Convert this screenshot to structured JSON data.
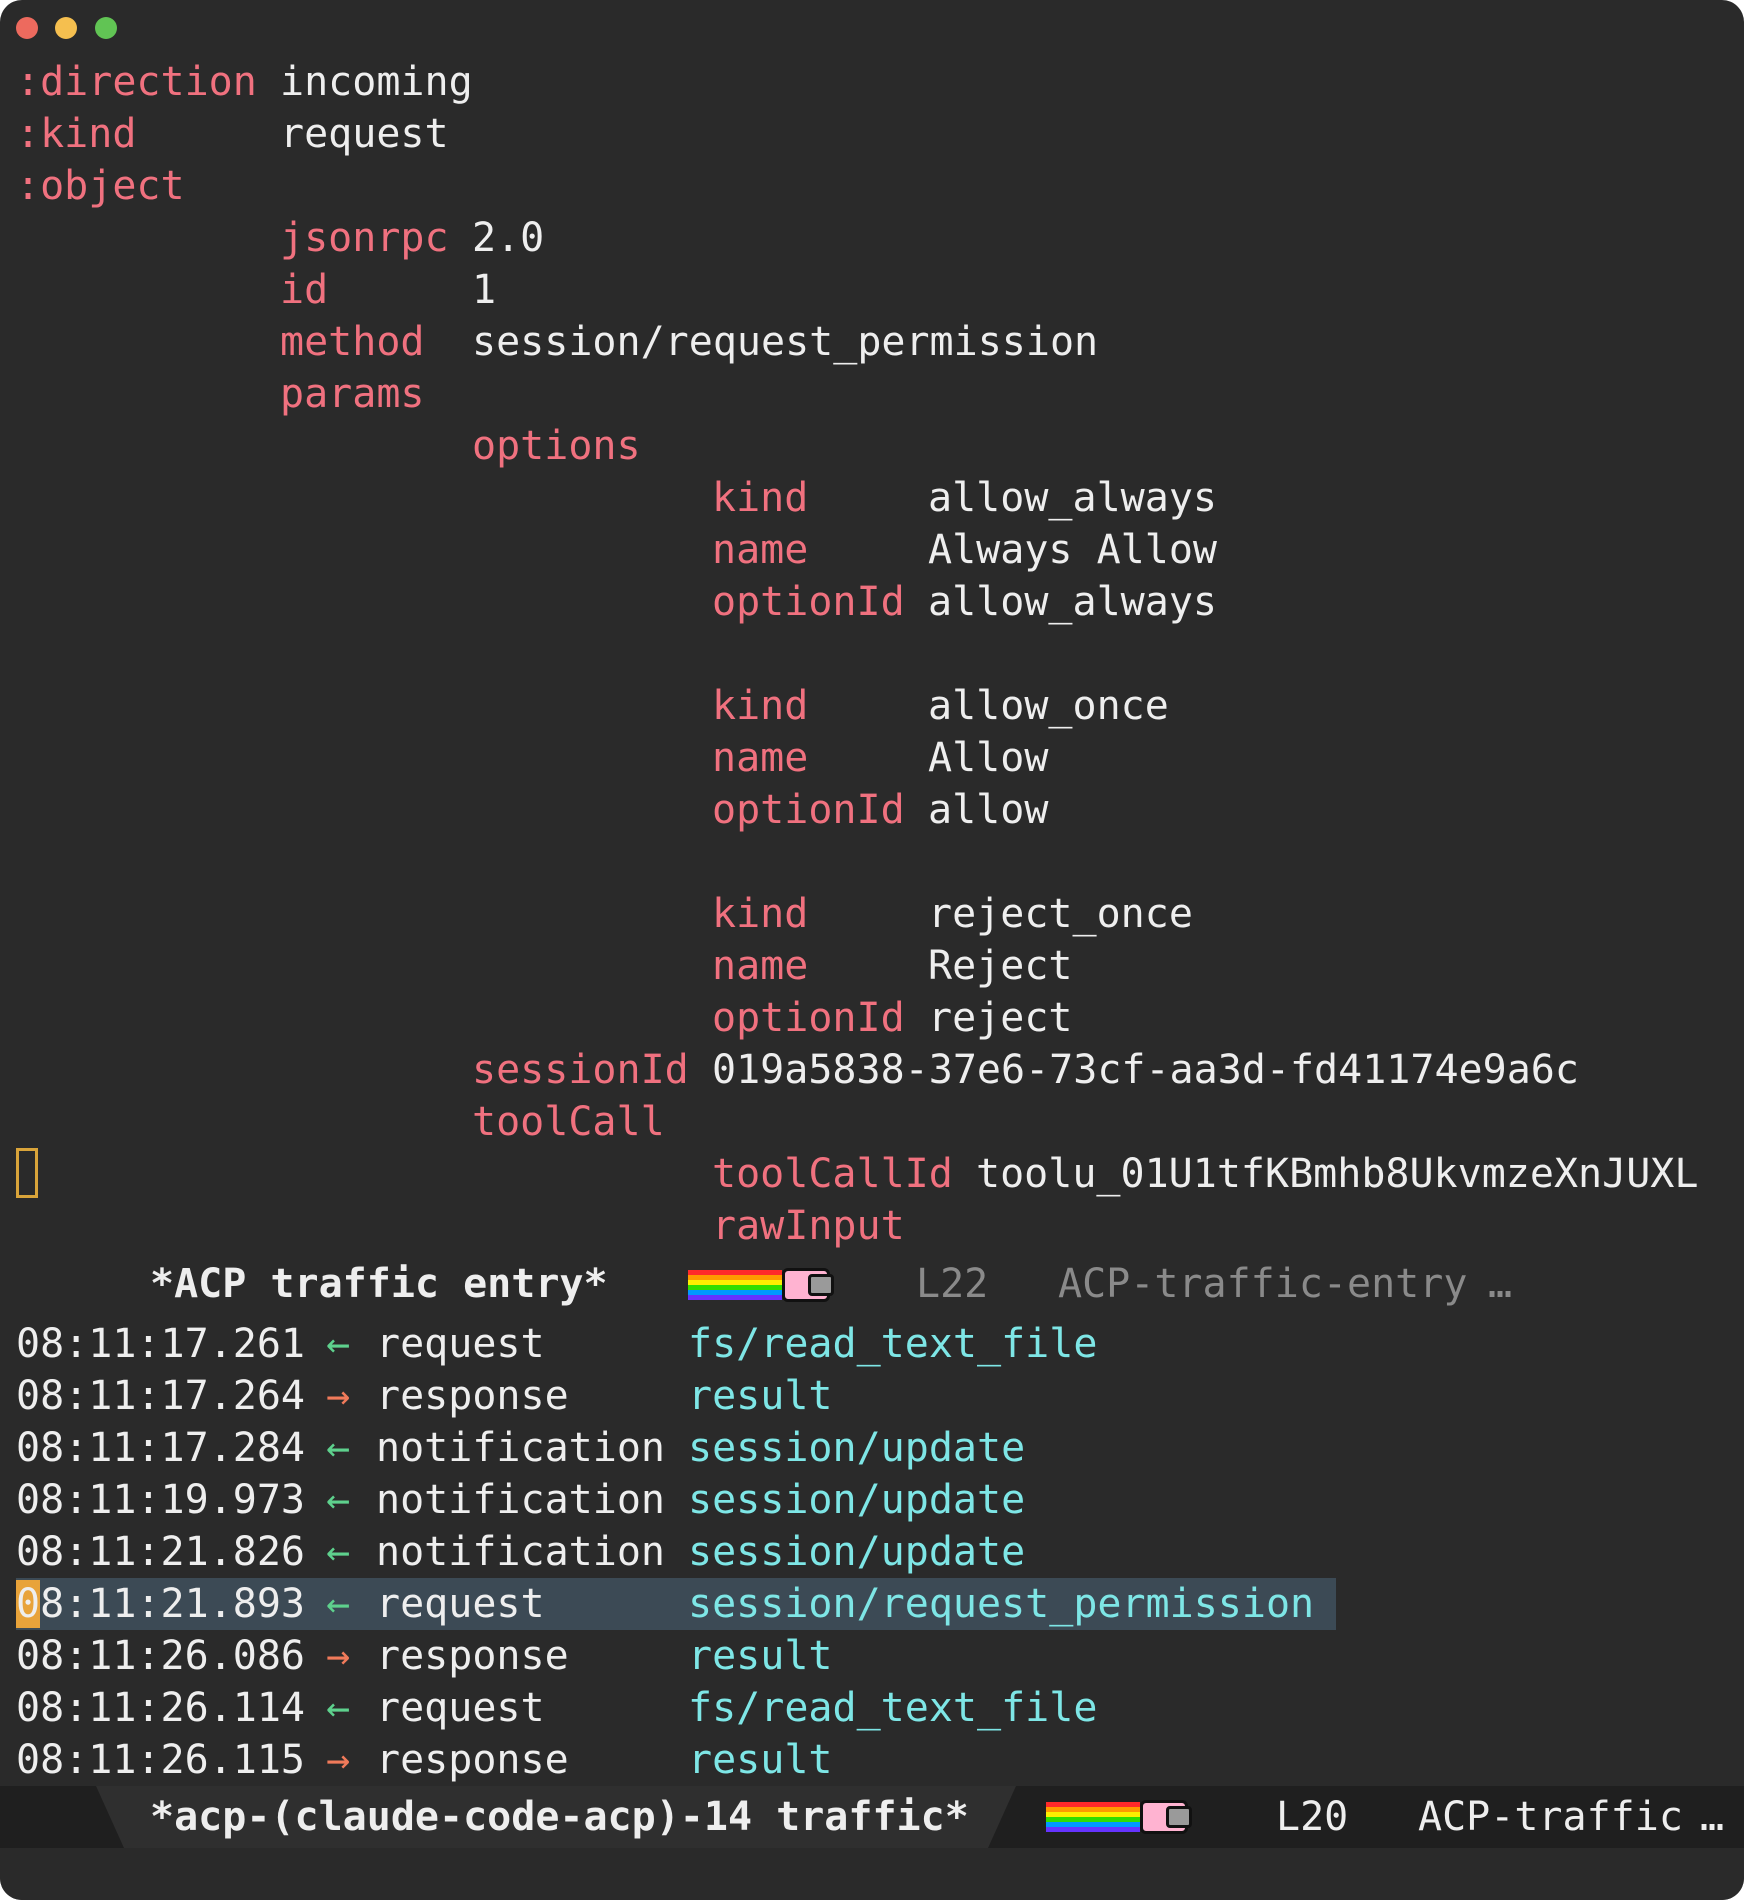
{
  "entry": {
    "direction_key": ":direction",
    "direction_val": "incoming",
    "kind_key": ":kind",
    "kind_val": "request",
    "object_key": ":object",
    "jsonrpc_key": "jsonrpc",
    "jsonrpc_val": "2.0",
    "id_key": "id",
    "id_val": "1",
    "method_key": "method",
    "method_val": "session/request_permission",
    "params_key": "params",
    "options_key": "options",
    "options": [
      {
        "kind_key": "kind",
        "kind": "allow_always",
        "name_key": "name",
        "name": "Always Allow",
        "optionId_key": "optionId",
        "optionId": "allow_always"
      },
      {
        "kind_key": "kind",
        "kind": "allow_once",
        "name_key": "name",
        "name": "Allow",
        "optionId_key": "optionId",
        "optionId": "allow"
      },
      {
        "kind_key": "kind",
        "kind": "reject_once",
        "name_key": "name",
        "name": "Reject",
        "optionId_key": "optionId",
        "optionId": "reject"
      }
    ],
    "sessionId_key": "sessionId",
    "sessionId_val": "019a5838-37e6-73cf-aa3d-fd41174e9a6c",
    "toolCall_key": "toolCall",
    "toolCallId_key": "toolCallId",
    "toolCallId_val": "toolu_01U1tfKBmhb8UkvmzeXnJUXL",
    "rawInput_key": "rawInput"
  },
  "modeline_top": {
    "buffer_name": "*ACP traffic entry*",
    "line": "L22",
    "mode": "ACP-traffic-entry",
    "ellipsis": "…"
  },
  "traffic": {
    "rows": [
      {
        "time": "08:11:17.261",
        "arrow": "←",
        "dir": "in",
        "kind": "request",
        "method": "fs/read_text_file"
      },
      {
        "time": "08:11:17.264",
        "arrow": "→",
        "dir": "out",
        "kind": "response",
        "method": "result"
      },
      {
        "time": "08:11:17.284",
        "arrow": "←",
        "dir": "in",
        "kind": "notification",
        "method": "session/update"
      },
      {
        "time": "08:11:19.973",
        "arrow": "←",
        "dir": "in",
        "kind": "notification",
        "method": "session/update"
      },
      {
        "time": "08:11:21.826",
        "arrow": "←",
        "dir": "in",
        "kind": "notification",
        "method": "session/update"
      },
      {
        "time": "08:11:21.893",
        "arrow": "←",
        "dir": "in",
        "kind": "request",
        "method": "session/request_permission"
      },
      {
        "time": "08:11:26.086",
        "arrow": "→",
        "dir": "out",
        "kind": "response",
        "method": "result"
      },
      {
        "time": "08:11:26.114",
        "arrow": "←",
        "dir": "in",
        "kind": "request",
        "method": "fs/read_text_file"
      },
      {
        "time": "08:11:26.115",
        "arrow": "→",
        "dir": "out",
        "kind": "response",
        "method": "result"
      }
    ],
    "selected_index": 5
  },
  "modeline_bottom": {
    "buffer_name": "*acp-(claude-code-acp)-14 traffic*",
    "line": "L20",
    "mode": "ACP-traffic",
    "ellipsis": "…"
  },
  "colors": {
    "background": "#2a2a2a",
    "key": "#f0717f",
    "value": "#eeeeee",
    "method": "#7ee6e6",
    "arrow_in": "#5ed18d",
    "arrow_out": "#f07a5a",
    "selection": "#3c4a55",
    "cursor": "#e8a33a"
  }
}
